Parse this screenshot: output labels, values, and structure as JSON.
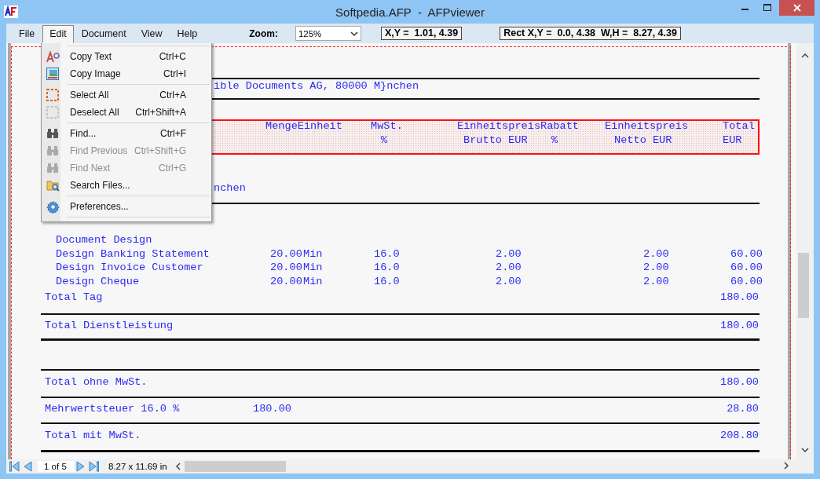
{
  "window": {
    "title": "Softpedia.AFP  -  AFPviewer"
  },
  "menu_bar": [
    {
      "label": "File",
      "selected": false
    },
    {
      "label": "Edit",
      "selected": true
    },
    {
      "label": "Document",
      "selected": false
    },
    {
      "label": "View",
      "selected": false
    },
    {
      "label": "Help",
      "selected": false
    }
  ],
  "toolbar": {
    "zoom_label": "Zoom:",
    "zoom_value": "125%",
    "cursor_readout": "X,Y =  1.01, 4.39",
    "rect_readout": "Rect X,Y =  0.0, 4.38  W,H =  8.27, 4.39"
  },
  "edit_menu": {
    "groups": [
      [
        {
          "label": "Copy Text",
          "shortcut": "Ctrl+C",
          "disabled": false
        },
        {
          "label": "Copy Image",
          "shortcut": "Ctrl+I",
          "disabled": false
        }
      ],
      [
        {
          "label": "Select All",
          "shortcut": "Ctrl+A",
          "disabled": false
        },
        {
          "label": "Deselect All",
          "shortcut": "Ctrl+Shift+A",
          "disabled": false
        }
      ],
      [
        {
          "label": "Find...",
          "shortcut": "Ctrl+F",
          "disabled": false
        },
        {
          "label": "Find Previous",
          "shortcut": "Ctrl+Shift+G",
          "disabled": true
        },
        {
          "label": "Find Next",
          "shortcut": "Ctrl+G",
          "disabled": true
        },
        {
          "label": "Search Files...",
          "disabled": false
        }
      ],
      [
        {
          "label": "Preferences...",
          "disabled": false
        }
      ]
    ]
  },
  "document": {
    "address": "ible Documents AG, 80000 M}nchen",
    "header_top": [
      "MengeEinheit",
      "MwSt.",
      "EinheitspreisRabatt",
      "Einheitspreis",
      "Total"
    ],
    "header_bottom": [
      "%",
      "Brutto EUR",
      "%",
      "Netto EUR",
      "EUR"
    ],
    "city": "nchen",
    "group": "Document Design",
    "items": [
      {
        "name": "Design Banking Statement",
        "quantity": "20.00",
        "unit": "Min",
        "vat": "16.0",
        "gross_price": "2.00",
        "net_price": "2.00",
        "total": "60.00"
      },
      {
        "name": "Design Invoice Customer",
        "quantity": "20.00",
        "unit": "Min",
        "vat": "16.0",
        "gross_price": "2.00",
        "net_price": "2.00",
        "total": "60.00"
      },
      {
        "name": "Design Cheque",
        "quantity": "20.00",
        "unit": "Min",
        "vat": "16.0",
        "gross_price": "2.00",
        "net_price": "2.00",
        "total": "60.00"
      }
    ],
    "totals": [
      {
        "label": "Total Tag",
        "amount": "180.00"
      },
      {
        "label": "Total Dienstleistung",
        "amount": "180.00"
      },
      {
        "label": "Total ohne MwSt.",
        "amount": "180.00"
      },
      {
        "label": "Mehrwertsteuer 16.0 %",
        "base": "180.00",
        "amount": "28.80"
      },
      {
        "label": "Total mit MwSt.",
        "amount": "208.80"
      }
    ]
  },
  "status_bar": {
    "page": "1 of 5",
    "page_size": "8.27 x 11.69 in"
  }
}
